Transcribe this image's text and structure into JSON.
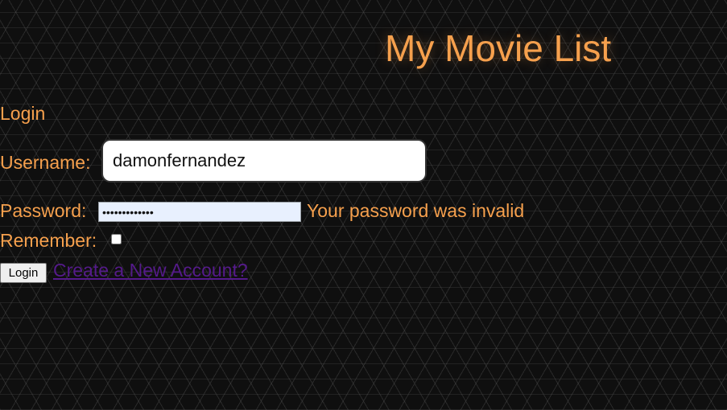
{
  "header": {
    "title": "My Movie List"
  },
  "login_form": {
    "heading": "Login",
    "username_label": "Username:",
    "username_value": "damonfernandez",
    "password_label": "Password:",
    "password_value": "•••••••••••••",
    "password_error": "Your password was invalid",
    "remember_label": "Remember:",
    "remember_checked": false,
    "login_button": "Login",
    "create_account_link": "Create a New Account?"
  },
  "colors": {
    "accent": "#f6a04d",
    "link_visited": "#551a8b",
    "background": "#0f0f0f"
  }
}
